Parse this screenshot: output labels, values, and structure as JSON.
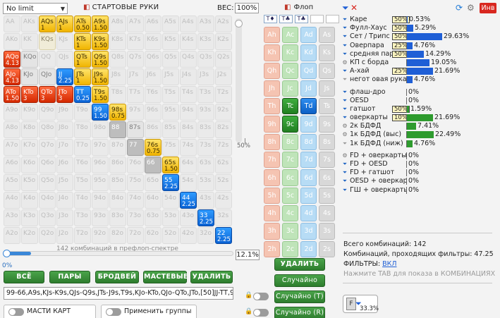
{
  "top": {
    "limit_select": "No limit",
    "start_hands_title": "СТАРТОВЫЕ РУКИ",
    "weight_label": "ВЕС:",
    "weight_value": "100%"
  },
  "grid": {
    "rows": [
      [
        {
          "l": "AA",
          "s": "e"
        },
        {
          "l": "AKs",
          "s": "e"
        },
        {
          "l": "AQs",
          "v": "1",
          "s": "gold"
        },
        {
          "l": "AJs",
          "v": "1",
          "s": "gold"
        },
        {
          "l": "ATs",
          "v": "0.50",
          "s": "gold"
        },
        {
          "l": "A9s",
          "v": "1.50",
          "s": "gold"
        },
        {
          "l": "A8s",
          "s": "e"
        },
        {
          "l": "A7s",
          "s": "e"
        },
        {
          "l": "A6s",
          "s": "e"
        },
        {
          "l": "A5s",
          "s": "e"
        },
        {
          "l": "A4s",
          "s": "e"
        },
        {
          "l": "A3s",
          "s": "e"
        },
        {
          "l": "A2s",
          "s": "e"
        }
      ],
      [
        {
          "l": "AKo",
          "s": "e"
        },
        {
          "l": "KK",
          "s": "e"
        },
        {
          "l": "KQs",
          "s": "ls"
        },
        {
          "l": "KJs",
          "s": "e"
        },
        {
          "l": "KTs",
          "v": "1",
          "s": "gold"
        },
        {
          "l": "K9s",
          "v": "1.50",
          "s": "gold"
        },
        {
          "l": "K8s",
          "s": "e"
        },
        {
          "l": "K7s",
          "s": "e"
        },
        {
          "l": "K6s",
          "s": "e"
        },
        {
          "l": "K5s",
          "s": "e"
        },
        {
          "l": "K4s",
          "s": "e"
        },
        {
          "l": "K3s",
          "s": "e"
        },
        {
          "l": "K2s",
          "s": "e"
        }
      ],
      [
        {
          "l": "AQo",
          "v": "4.13",
          "s": "red"
        },
        {
          "l": "KQo",
          "s": "light"
        },
        {
          "l": "QQ",
          "s": "e"
        },
        {
          "l": "QJs",
          "s": "e"
        },
        {
          "l": "QTs",
          "v": "1",
          "s": "gold"
        },
        {
          "l": "Q9s",
          "v": "1.50",
          "s": "gold"
        },
        {
          "l": "Q8s",
          "s": "e"
        },
        {
          "l": "Q7s",
          "s": "e"
        },
        {
          "l": "Q6s",
          "s": "e"
        },
        {
          "l": "Q5s",
          "s": "e"
        },
        {
          "l": "Q4s",
          "s": "e"
        },
        {
          "l": "Q3s",
          "s": "e"
        },
        {
          "l": "Q2s",
          "s": "e"
        }
      ],
      [
        {
          "l": "AJo",
          "v": "4.13",
          "s": "red"
        },
        {
          "l": "KJo",
          "s": "light"
        },
        {
          "l": "QJo",
          "s": "light"
        },
        {
          "l": "JJ",
          "v": "2.25",
          "s": "blue"
        },
        {
          "l": "JTs",
          "v": "1",
          "s": "gold"
        },
        {
          "l": "J9s",
          "v": "1.50",
          "s": "gold"
        },
        {
          "l": "J8s",
          "s": "e"
        },
        {
          "l": "J7s",
          "s": "e"
        },
        {
          "l": "J6s",
          "s": "e"
        },
        {
          "l": "J5s",
          "s": "e"
        },
        {
          "l": "J4s",
          "s": "e"
        },
        {
          "l": "J3s",
          "s": "e"
        },
        {
          "l": "J2s",
          "s": "e"
        }
      ],
      [
        {
          "l": "ATo",
          "v": "1.50",
          "s": "red"
        },
        {
          "l": "KTo",
          "v": "3",
          "s": "red"
        },
        {
          "l": "QTo",
          "v": "3",
          "s": "red"
        },
        {
          "l": "JTo",
          "v": "3",
          "s": "red"
        },
        {
          "l": "TT",
          "v": "0.25",
          "s": "blue"
        },
        {
          "l": "T9s",
          "v": "1.50",
          "s": "gold"
        },
        {
          "l": "T8s",
          "s": "e"
        },
        {
          "l": "T7s",
          "s": "e"
        },
        {
          "l": "T6s",
          "s": "e"
        },
        {
          "l": "T5s",
          "s": "e"
        },
        {
          "l": "T4s",
          "s": "e"
        },
        {
          "l": "T3s",
          "s": "e"
        },
        {
          "l": "T2s",
          "s": "e"
        }
      ],
      [
        {
          "l": "A9o",
          "s": "e"
        },
        {
          "l": "K9o",
          "s": "e"
        },
        {
          "l": "Q9o",
          "s": "e"
        },
        {
          "l": "J9o",
          "s": "e"
        },
        {
          "l": "T9o",
          "s": "e"
        },
        {
          "l": "99",
          "v": "1.50",
          "s": "blue"
        },
        {
          "l": "98s",
          "v": "0.75",
          "s": "gold"
        },
        {
          "l": "97s",
          "s": "e"
        },
        {
          "l": "96s",
          "s": "e"
        },
        {
          "l": "95s",
          "s": "e"
        },
        {
          "l": "94s",
          "s": "e"
        },
        {
          "l": "93s",
          "s": "e"
        },
        {
          "l": "92s",
          "s": "e"
        }
      ],
      [
        {
          "l": "A8o",
          "s": "e"
        },
        {
          "l": "K8o",
          "s": "e"
        },
        {
          "l": "Q8o",
          "s": "e"
        },
        {
          "l": "J8o",
          "s": "e"
        },
        {
          "l": "T8o",
          "s": "e"
        },
        {
          "l": "98o",
          "s": "e"
        },
        {
          "l": "88",
          "s": "gray"
        },
        {
          "l": "87s",
          "s": "light"
        },
        {
          "l": "86s",
          "s": "e"
        },
        {
          "l": "85s",
          "s": "e"
        },
        {
          "l": "84s",
          "s": "e"
        },
        {
          "l": "83s",
          "s": "e"
        },
        {
          "l": "82s",
          "s": "e"
        }
      ],
      [
        {
          "l": "A7o",
          "s": "e"
        },
        {
          "l": "K7o",
          "s": "e"
        },
        {
          "l": "Q7o",
          "s": "e"
        },
        {
          "l": "J7o",
          "s": "e"
        },
        {
          "l": "T7o",
          "s": "e"
        },
        {
          "l": "97o",
          "s": "e"
        },
        {
          "l": "87o",
          "s": "e"
        },
        {
          "l": "77",
          "s": "gray"
        },
        {
          "l": "76s",
          "v": "0.75",
          "s": "gold"
        },
        {
          "l": "75s",
          "s": "e"
        },
        {
          "l": "74s",
          "s": "e"
        },
        {
          "l": "73s",
          "s": "e"
        },
        {
          "l": "72s",
          "s": "e"
        }
      ],
      [
        {
          "l": "A6o",
          "s": "e"
        },
        {
          "l": "K6o",
          "s": "e"
        },
        {
          "l": "Q6o",
          "s": "e"
        },
        {
          "l": "J6o",
          "s": "e"
        },
        {
          "l": "T6o",
          "s": "e"
        },
        {
          "l": "96o",
          "s": "e"
        },
        {
          "l": "86o",
          "s": "e"
        },
        {
          "l": "76o",
          "s": "e"
        },
        {
          "l": "66",
          "s": "gray"
        },
        {
          "l": "65s",
          "v": "1.50",
          "s": "gold"
        },
        {
          "l": "64s",
          "s": "e"
        },
        {
          "l": "63s",
          "s": "e"
        },
        {
          "l": "62s",
          "s": "e"
        }
      ],
      [
        {
          "l": "A5o",
          "s": "e"
        },
        {
          "l": "K5o",
          "s": "e"
        },
        {
          "l": "Q5o",
          "s": "e"
        },
        {
          "l": "J5o",
          "s": "e"
        },
        {
          "l": "T5o",
          "s": "e"
        },
        {
          "l": "95o",
          "s": "e"
        },
        {
          "l": "85o",
          "s": "e"
        },
        {
          "l": "75o",
          "s": "e"
        },
        {
          "l": "65o",
          "s": "e"
        },
        {
          "l": "55",
          "v": "2.25",
          "s": "blue"
        },
        {
          "l": "54s",
          "s": "e"
        },
        {
          "l": "53s",
          "s": "e"
        },
        {
          "l": "52s",
          "s": "e"
        }
      ],
      [
        {
          "l": "A4o",
          "s": "e"
        },
        {
          "l": "K4o",
          "s": "e"
        },
        {
          "l": "Q4o",
          "s": "e"
        },
        {
          "l": "J4o",
          "s": "e"
        },
        {
          "l": "T4o",
          "s": "e"
        },
        {
          "l": "94o",
          "s": "e"
        },
        {
          "l": "84o",
          "s": "e"
        },
        {
          "l": "74o",
          "s": "e"
        },
        {
          "l": "64o",
          "s": "e"
        },
        {
          "l": "54o",
          "s": "e"
        },
        {
          "l": "44",
          "v": "2.25",
          "s": "blue"
        },
        {
          "l": "43s",
          "s": "e"
        },
        {
          "l": "42s",
          "s": "e"
        }
      ],
      [
        {
          "l": "A3o",
          "s": "e"
        },
        {
          "l": "K3o",
          "s": "e"
        },
        {
          "l": "Q3o",
          "s": "e"
        },
        {
          "l": "J3o",
          "s": "e"
        },
        {
          "l": "T3o",
          "s": "e"
        },
        {
          "l": "93o",
          "s": "e"
        },
        {
          "l": "83o",
          "s": "e"
        },
        {
          "l": "73o",
          "s": "e"
        },
        {
          "l": "63o",
          "s": "e"
        },
        {
          "l": "53o",
          "s": "e"
        },
        {
          "l": "43o",
          "s": "e"
        },
        {
          "l": "33",
          "v": "2.25",
          "s": "blue"
        },
        {
          "l": "32s",
          "s": "e"
        }
      ],
      [
        {
          "l": "A2o",
          "s": "e"
        },
        {
          "l": "K2o",
          "s": "e"
        },
        {
          "l": "Q2o",
          "s": "e"
        },
        {
          "l": "J2o",
          "s": "e"
        },
        {
          "l": "T2o",
          "s": "e"
        },
        {
          "l": "92o",
          "s": "e"
        },
        {
          "l": "82o",
          "s": "e"
        },
        {
          "l": "72o",
          "s": "e"
        },
        {
          "l": "62o",
          "s": "e"
        },
        {
          "l": "52o",
          "s": "e"
        },
        {
          "l": "42o",
          "s": "e"
        },
        {
          "l": "32o",
          "s": "e"
        },
        {
          "l": "22",
          "v": "2.25",
          "s": "blue"
        }
      ]
    ]
  },
  "grid_scroll_pct": "50%",
  "combo_text": "142 комбинаций в префлоп-спектре",
  "range_pct": "12.1%",
  "slider_pct": "0%",
  "buttons": {
    "all": "ВСЁ",
    "pairs": "ПАРЫ",
    "broadway": "БРОДВЕЙ",
    "suited": "МАСТЕВЫЕ",
    "delete": "УДАЛИТЬ"
  },
  "range_text": "99-66,A9s,KJs-K9s,QJs-Q9s,JTs-J9s,T9s,KJo-KTo,QJo-QTo,JTo,[50]JJ-TT,98s,76s",
  "bottom": {
    "suits_label": "МАСТИ КАРТ",
    "apply_groups": "Применить группы"
  },
  "flop": {
    "title": "Флоп",
    "suit_filters": [
      "T♦",
      "T♣",
      "T♣"
    ],
    "cards": [
      [
        {
          "r": "Ah",
          "s": "h"
        },
        {
          "r": "Ac",
          "s": "c"
        },
        {
          "r": "Ad",
          "s": "d"
        },
        {
          "r": "As",
          "s": "s"
        }
      ],
      [
        {
          "r": "Kh",
          "s": "h"
        },
        {
          "r": "Kc",
          "s": "c"
        },
        {
          "r": "Kd",
          "s": "d"
        },
        {
          "r": "Ks",
          "s": "s"
        }
      ],
      [
        {
          "r": "Qh",
          "s": "h"
        },
        {
          "r": "Qc",
          "s": "c"
        },
        {
          "r": "Qd",
          "s": "d"
        },
        {
          "r": "Qs",
          "s": "s"
        }
      ],
      [
        {
          "r": "Jh",
          "s": "h"
        },
        {
          "r": "Jc",
          "s": "c"
        },
        {
          "r": "Jd",
          "s": "d"
        },
        {
          "r": "Js",
          "s": "s"
        }
      ],
      [
        {
          "r": "Th",
          "s": "h"
        },
        {
          "r": "Tc",
          "s": "csel"
        },
        {
          "r": "Td",
          "s": "dsel"
        },
        {
          "r": "Ts",
          "s": "s"
        }
      ],
      [
        {
          "r": "9h",
          "s": "h"
        },
        {
          "r": "9c",
          "s": "csel"
        },
        {
          "r": "9d",
          "s": "d"
        },
        {
          "r": "9s",
          "s": "s"
        }
      ],
      [
        {
          "r": "8h",
          "s": "h"
        },
        {
          "r": "8c",
          "s": "c"
        },
        {
          "r": "8d",
          "s": "d"
        },
        {
          "r": "8s",
          "s": "s"
        }
      ],
      [
        {
          "r": "7h",
          "s": "h"
        },
        {
          "r": "7c",
          "s": "c"
        },
        {
          "r": "7d",
          "s": "d"
        },
        {
          "r": "7s",
          "s": "s"
        }
      ],
      [
        {
          "r": "6h",
          "s": "h"
        },
        {
          "r": "6c",
          "s": "c"
        },
        {
          "r": "6d",
          "s": "d"
        },
        {
          "r": "6s",
          "s": "s"
        }
      ],
      [
        {
          "r": "5h",
          "s": "h"
        },
        {
          "r": "5c",
          "s": "c"
        },
        {
          "r": "5d",
          "s": "d"
        },
        {
          "r": "5s",
          "s": "s"
        }
      ],
      [
        {
          "r": "4h",
          "s": "h"
        },
        {
          "r": "4c",
          "s": "c"
        },
        {
          "r": "4d",
          "s": "d"
        },
        {
          "r": "4s",
          "s": "s"
        }
      ],
      [
        {
          "r": "3h",
          "s": "h"
        },
        {
          "r": "3c",
          "s": "c"
        },
        {
          "r": "3d",
          "s": "d"
        },
        {
          "r": "3s",
          "s": "s"
        }
      ],
      [
        {
          "r": "2h",
          "s": "h"
        },
        {
          "r": "2c",
          "s": "c"
        },
        {
          "r": "2d",
          "s": "d"
        },
        {
          "r": "2s",
          "s": "s"
        }
      ]
    ],
    "btn_delete": "УДАЛИТЬ",
    "btn_random": "Случайно",
    "btn_random_t": "Случайно (T)",
    "btn_random_r": "Случайно (R)"
  },
  "inv_label": "Инв",
  "stats": [
    {
      "label": "Каре",
      "badge": "50%",
      "value": "0.53%",
      "pct": 0.53,
      "color": "#1f5fd6"
    },
    {
      "label": "Фулл-Хаус",
      "badge": "50%",
      "value": "5.29%",
      "pct": 5.29,
      "color": "#1f5fd6"
    },
    {
      "label": "Сет / Трипс",
      "badge": "50%",
      "value": "29.63%",
      "pct": 29.63,
      "color": "#1f5fd6"
    },
    {
      "label": "Оверпара",
      "badge": "25%",
      "value": "4.76%",
      "pct": 4.76,
      "color": "#1f5fd6"
    },
    {
      "label": "средняя пара",
      "badge": "50%",
      "value": "14.29%",
      "pct": 14.29,
      "color": "#1f5fd6"
    },
    {
      "label": "КП с борда",
      "value": "19.05%",
      "pct": 19.05,
      "color": "#1f5fd6",
      "gear": true
    },
    {
      "label": "А-хай",
      "badge": "25%",
      "value": "21.69%",
      "pct": 21.69,
      "color": "#1f5fd6"
    },
    {
      "label": "негот овая рука",
      "value": "4.76%",
      "pct": 4.76,
      "color": "#1f5fd6",
      "light": true
    },
    {
      "label": "флаш-дро",
      "value": "0%",
      "pct": 0,
      "color": "#2e9b2e",
      "gap": true
    },
    {
      "label": "OESD",
      "value": "0%",
      "pct": 0,
      "color": "#2e9b2e"
    },
    {
      "label": "гатшот",
      "badge": "50%",
      "value": "1.59%",
      "pct": 1.59,
      "color": "#2e9b2e"
    },
    {
      "label": "оверкарты",
      "badge": "10%",
      "value": "21.69%",
      "pct": 21.69,
      "color": "#2e9b2e"
    },
    {
      "label": "2к БДФД",
      "value": "7.41%",
      "pct": 7.41,
      "color": "#2e9b2e",
      "gear": true
    },
    {
      "label": "1к БДФД (выс)",
      "value": "22.49%",
      "pct": 22.49,
      "color": "#2e9b2e",
      "gear": true
    },
    {
      "label": "1к БДФД (ниж)",
      "value": "4.76%",
      "pct": 4.76,
      "color": "#2e9b2e",
      "light": true
    },
    {
      "label": "FD + оверкарты",
      "value": "0%",
      "pct": 0,
      "color": "#2e9b2e",
      "gap": true,
      "gear": true
    },
    {
      "label": "FD + OESD",
      "value": "0%",
      "pct": 0,
      "color": "#2e9b2e"
    },
    {
      "label": "FD + гатшот",
      "value": "0%",
      "pct": 0,
      "color": "#2e9b2e"
    },
    {
      "label": "OESD + оверкарты",
      "value": "0%",
      "pct": 0,
      "color": "#2e9b2e"
    },
    {
      "label": "ГШ + оверкарты",
      "value": "0%",
      "pct": 0,
      "color": "#2e9b2e"
    }
  ],
  "info": {
    "total": "Всего комбинаций: 142",
    "passing": "Комбинаций, проходящих фильтры: 47.25",
    "filters_label": "ФИЛЬТРЫ:",
    "filters_state": "ВКЛ",
    "hint": "Нажмите TAB для показа в КОМБИНАЦИЯХ"
  },
  "status_pct": "33.3%"
}
